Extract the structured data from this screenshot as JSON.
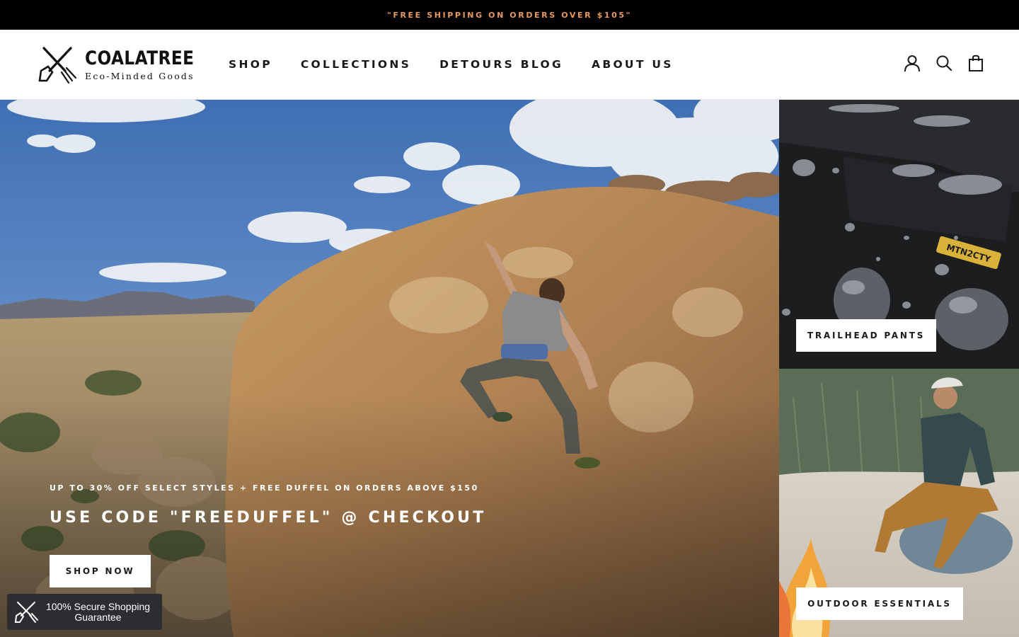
{
  "announcement": {
    "text": "\"FREE SHIPPING ON ORDERS OVER $105\""
  },
  "brand": {
    "name": "COALATREE",
    "tagline": "Eco-Minded Goods"
  },
  "nav": {
    "items": [
      {
        "label": "SHOP"
      },
      {
        "label": "COLLECTIONS"
      },
      {
        "label": "DETOURS BLOG"
      },
      {
        "label": "ABOUT US"
      }
    ]
  },
  "header_icons": [
    "account-icon",
    "search-icon",
    "cart-icon"
  ],
  "hero": {
    "subtitle": "UP TO 30% OFF SELECT STYLES + FREE DUFFEL ON ORDERS ABOVE $150",
    "title": "USE CODE \"FREEDUFFEL\" @ CHECKOUT",
    "button_label": "SHOP NOW"
  },
  "tiles": [
    {
      "button_label": "TRAILHEAD PANTS"
    },
    {
      "button_label": "OUTDOOR ESSENTIALS"
    }
  ],
  "product_label": "MTN2CTY",
  "trust_badge": {
    "text": "100% Secure Shopping Guarantee"
  },
  "colors": {
    "announcement_bg": "#000000",
    "announcement_text": "#e89a5f",
    "badge_bg": "#2b2d31"
  }
}
